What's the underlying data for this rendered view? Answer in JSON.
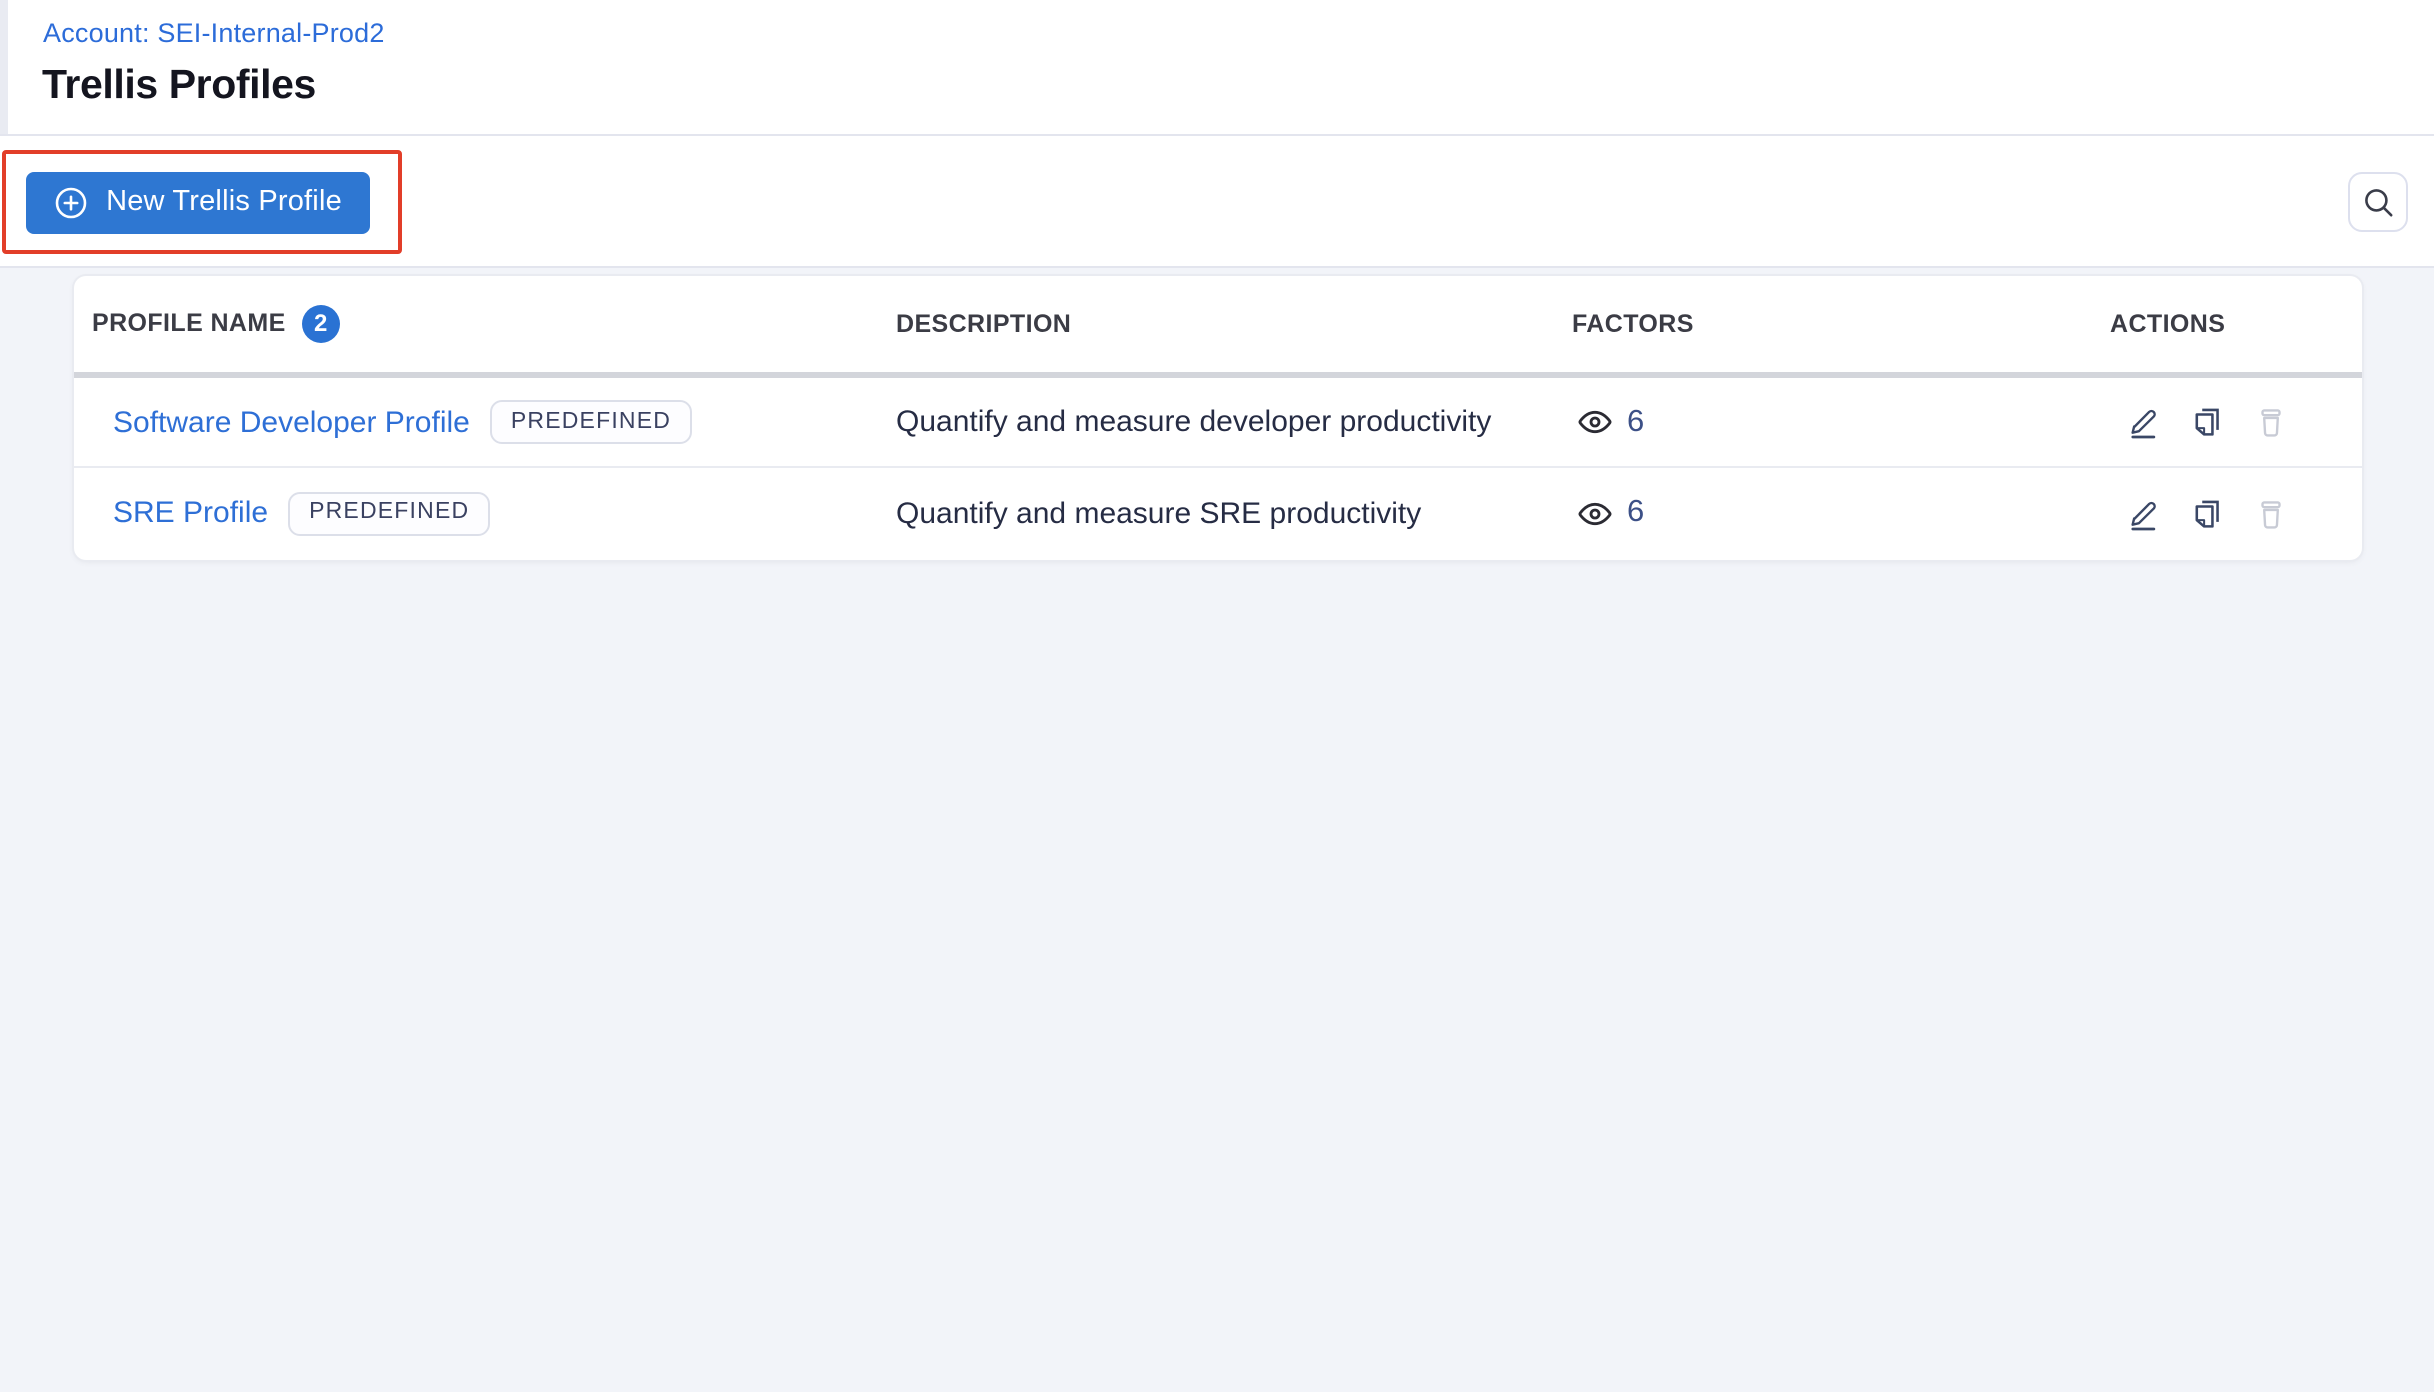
{
  "header": {
    "account_link": "Account: SEI-Internal-Prod2",
    "page_title": "Trellis Profiles"
  },
  "toolbar": {
    "new_profile_button": "New Trellis Profile"
  },
  "table": {
    "columns": {
      "name": "PROFILE NAME",
      "description": "DESCRIPTION",
      "factors": "FACTORS",
      "actions": "ACTIONS"
    },
    "row_count_badge": "2",
    "rows": [
      {
        "name": "Software Developer Profile",
        "tag": "PREDEFINED",
        "description": "Quantify and measure developer productivity",
        "factors": "6"
      },
      {
        "name": "SRE Profile",
        "tag": "PREDEFINED",
        "description": "Quantify and measure SRE productivity",
        "factors": "6"
      }
    ]
  },
  "annotation": {
    "type": "highlight-box",
    "target": "new-trellis-profile-button",
    "color": "#e23e29"
  },
  "colors": {
    "primary_button": "#2e77d2",
    "link": "#2e6fd6",
    "count_badge": "#2a72d3",
    "annotation_red": "#e23e29",
    "action_icon": "#3a4766",
    "disabled_icon": "#c8cbd5",
    "factors_text": "#3c5087",
    "page_background": "#f2f4f9"
  }
}
